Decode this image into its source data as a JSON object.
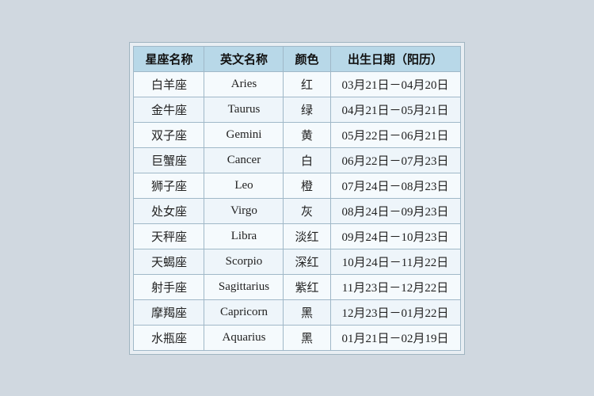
{
  "table": {
    "headers": {
      "chinese_name": "星座名称",
      "english_name": "英文名称",
      "color": "颜色",
      "date": "出生日期（阳历）"
    },
    "rows": [
      {
        "chinese": "白羊座",
        "english": "Aries",
        "color": "红",
        "date": "03月21日－04月20日"
      },
      {
        "chinese": "金牛座",
        "english": "Taurus",
        "color": "绿",
        "date": "04月21日－05月21日"
      },
      {
        "chinese": "双子座",
        "english": "Gemini",
        "color": "黄",
        "date": "05月22日－06月21日"
      },
      {
        "chinese": "巨蟹座",
        "english": "Cancer",
        "color": "白",
        "date": "06月22日－07月23日"
      },
      {
        "chinese": "狮子座",
        "english": "Leo",
        "color": "橙",
        "date": "07月24日－08月23日"
      },
      {
        "chinese": "处女座",
        "english": "Virgo",
        "color": "灰",
        "date": "08月24日－09月23日"
      },
      {
        "chinese": "天秤座",
        "english": "Libra",
        "color": "淡红",
        "date": "09月24日－10月23日"
      },
      {
        "chinese": "天蝎座",
        "english": "Scorpio",
        "color": "深红",
        "date": "10月24日－11月22日"
      },
      {
        "chinese": "射手座",
        "english": "Sagittarius",
        "color": "紫红",
        "date": "11月23日－12月22日"
      },
      {
        "chinese": "摩羯座",
        "english": "Capricorn",
        "color": "黑",
        "date": "12月23日－01月22日"
      },
      {
        "chinese": "水瓶座",
        "english": "Aquarius",
        "color": "黑",
        "date": "01月21日－02月19日"
      }
    ]
  }
}
